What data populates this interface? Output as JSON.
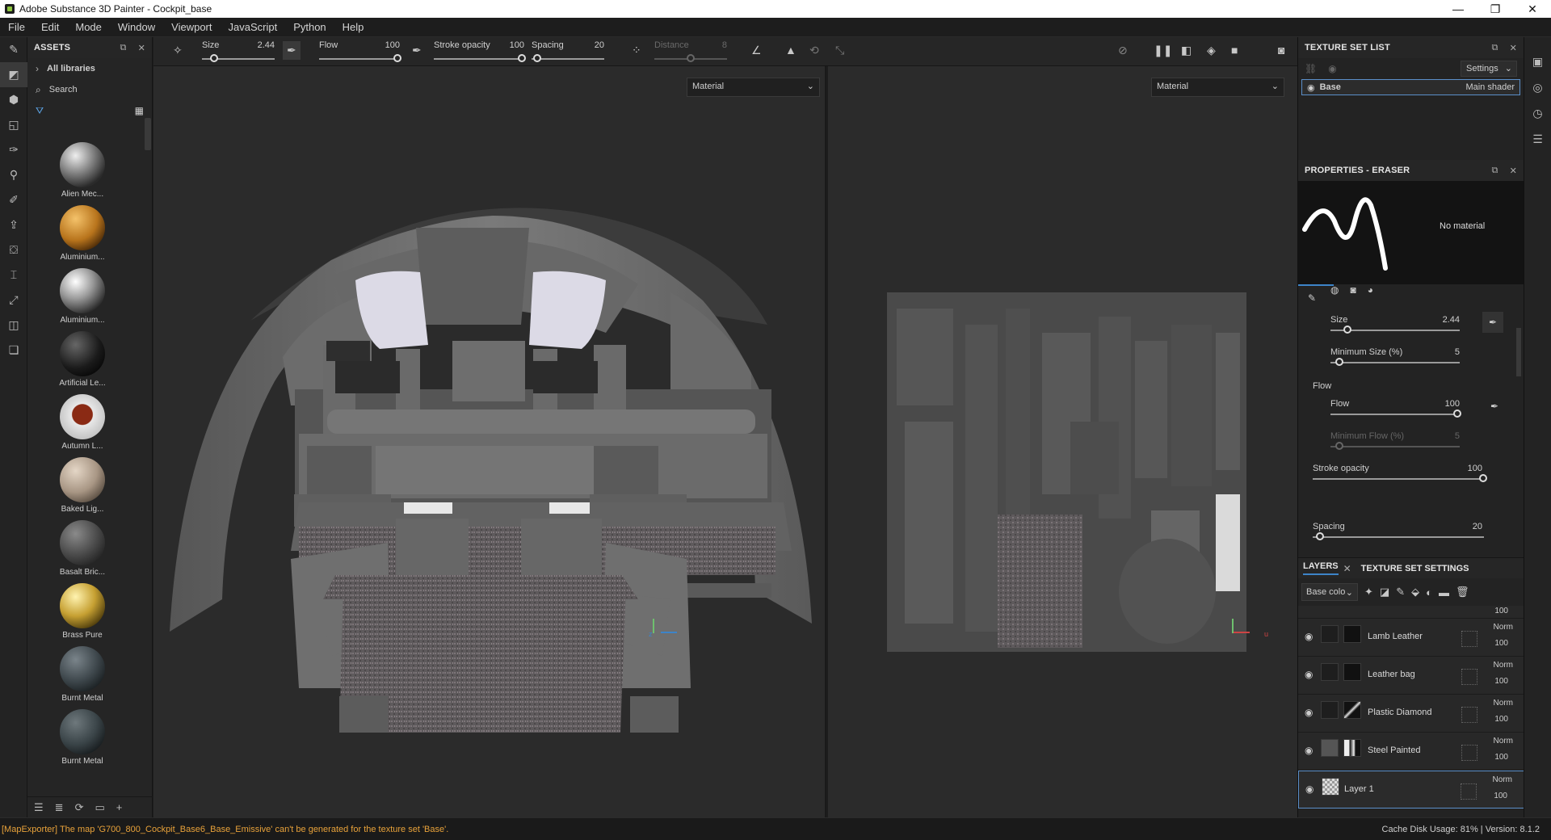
{
  "window": {
    "title": "Adobe Substance 3D Painter - Cockpit_base",
    "controls": [
      "—",
      "❐",
      "✕"
    ]
  },
  "menu": [
    "File",
    "Edit",
    "Mode",
    "Window",
    "Viewport",
    "JavaScript",
    "Python",
    "Help"
  ],
  "assets": {
    "title": "ASSETS",
    "all_libraries": "All libraries",
    "search_placeholder": "Search",
    "items": [
      {
        "name": "Alien Mec..."
      },
      {
        "name": "Aluminium..."
      },
      {
        "name": "Aluminium..."
      },
      {
        "name": "Artificial Le..."
      },
      {
        "name": "Autumn L..."
      },
      {
        "name": "Baked Lig..."
      },
      {
        "name": "Basalt Bric..."
      },
      {
        "name": "Brass Pure"
      },
      {
        "name": "Burnt Metal"
      },
      {
        "name": "Burnt Metal"
      }
    ]
  },
  "toolbar": {
    "size_label": "Size",
    "size_value": "2.44",
    "flow_label": "Flow",
    "flow_value": "100",
    "stroke_label": "Stroke opacity",
    "stroke_value": "100",
    "spacing_label": "Spacing",
    "spacing_value": "20",
    "distance_label": "Distance",
    "distance_value": "8"
  },
  "viewport": {
    "left_mode": "Material",
    "right_mode": "Material"
  },
  "texture_set_list": {
    "title": "TEXTURE SET LIST",
    "settings": "Settings",
    "base_name": "Base",
    "base_shader": "Main shader"
  },
  "properties": {
    "title": "PROPERTIES - ERASER",
    "no_material": "No material",
    "size_label": "Size",
    "size_value": "2.44",
    "min_size_label": "Minimum Size (%)",
    "min_size_value": "5",
    "flow_section": "Flow",
    "flow_label": "Flow",
    "flow_value": "100",
    "min_flow_label": "Minimum Flow (%)",
    "min_flow_value": "5",
    "stroke_label": "Stroke opacity",
    "stroke_value": "100",
    "spacing_label": "Spacing",
    "spacing_value": "20"
  },
  "layers": {
    "tab_layers": "LAYERS",
    "tab_tss": "TEXTURE SET SETTINGS",
    "channel": "Base colo",
    "top_opacity": "100",
    "items": [
      {
        "name": "Lamb Leather",
        "blend": "Norm",
        "opacity": "100"
      },
      {
        "name": "Leather bag",
        "blend": "Norm",
        "opacity": "100"
      },
      {
        "name": "Plastic Diamond",
        "blend": "Norm",
        "opacity": "100"
      },
      {
        "name": "Steel Painted",
        "blend": "Norm",
        "opacity": "100"
      },
      {
        "name": "Layer 1",
        "blend": "Norm",
        "opacity": "100"
      }
    ]
  },
  "status": {
    "error": "[MapExporter] The map 'G700_800_Cockpit_Base6_Base_Emissive' can't be generated for the texture set 'Base'.",
    "right": "Cache Disk Usage:    81% | Version: 8.1.2"
  }
}
